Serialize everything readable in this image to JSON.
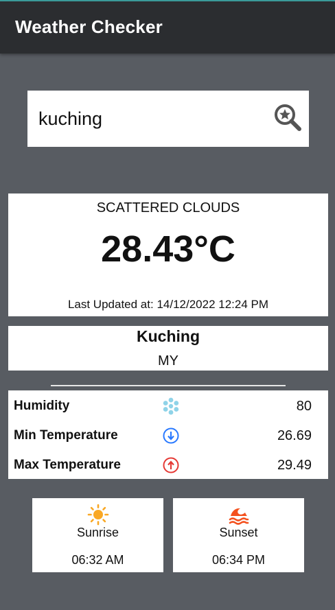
{
  "app": {
    "title": "Weather Checker"
  },
  "search": {
    "value": "kuching",
    "icon": "search-star-icon"
  },
  "weather": {
    "description": "SCATTERED CLOUDS",
    "temperature": "28.43°C",
    "updated_label": "Last Updated at:",
    "updated_value": "14/12/2022 12:24 PM"
  },
  "location": {
    "city": "Kuching",
    "country": "MY"
  },
  "stats": [
    {
      "label": "Humidity",
      "value": "80",
      "icon": "humidity-snowflake-icon",
      "color": "#8fd3e8"
    },
    {
      "label": "Min Temperature",
      "value": "26.69",
      "icon": "arrow-down-circle-icon",
      "color": "#2979ff"
    },
    {
      "label": "Max Temperature",
      "value": "29.49",
      "icon": "arrow-up-circle-icon",
      "color": "#e53935"
    }
  ],
  "sun": {
    "sunrise": {
      "label": "Sunrise",
      "time": "06:32 AM",
      "icon": "sun-icon",
      "color": "#f9a825"
    },
    "sunset": {
      "label": "Sunset",
      "time": "06:34 PM",
      "icon": "sunset-waves-icon",
      "color": "#f4511e"
    }
  },
  "colors": {
    "background": "#585c62",
    "appbar": "#2b2d30"
  }
}
